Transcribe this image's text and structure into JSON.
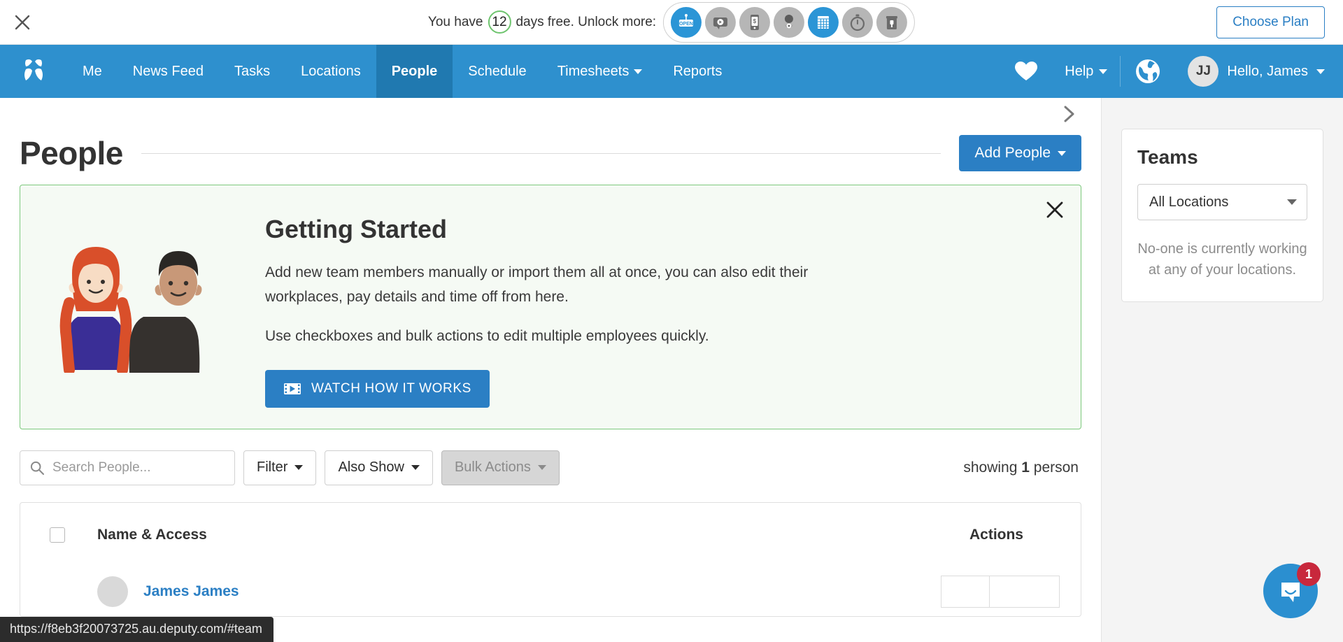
{
  "trial_banner": {
    "close_icon": "close-icon",
    "text_before": "You have",
    "days": "12",
    "text_after": "days free. Unlock more:",
    "feature_icons": [
      {
        "name": "open-sign-icon",
        "active": true
      },
      {
        "name": "video-message-icon",
        "active": false
      },
      {
        "name": "mobile-payments-icon",
        "active": false
      },
      {
        "name": "location-pin-person-icon",
        "active": false
      },
      {
        "name": "calendar-icon",
        "active": true
      },
      {
        "name": "stopwatch-icon",
        "active": false
      },
      {
        "name": "kiosk-icon",
        "active": false
      }
    ],
    "choose_plan_label": "Choose Plan"
  },
  "navbar": {
    "logo": "deputy-logo",
    "items": [
      {
        "label": "Me",
        "active": false,
        "has_caret": false
      },
      {
        "label": "News Feed",
        "active": false,
        "has_caret": false
      },
      {
        "label": "Tasks",
        "active": false,
        "has_caret": false
      },
      {
        "label": "Locations",
        "active": false,
        "has_caret": false
      },
      {
        "label": "People",
        "active": true,
        "has_caret": false
      },
      {
        "label": "Schedule",
        "active": false,
        "has_caret": false
      },
      {
        "label": "Timesheets",
        "active": false,
        "has_caret": true
      },
      {
        "label": "Reports",
        "active": false,
        "has_caret": false
      }
    ],
    "heart_icon": "heart-icon",
    "help_label": "Help",
    "globe_icon": "globe-icon",
    "user_initials": "JJ",
    "user_greeting": "Hello, James",
    "accent_color": "#2e90ce",
    "active_color": "#2079b0"
  },
  "main": {
    "page_title": "People",
    "add_people_label": "Add People",
    "collapse_icon": "chevron-right-icon",
    "getting_started": {
      "heading": "Getting Started",
      "paragraph_1": "Add new team members manually or import them all at once, you can also edit their workplaces, pay details and time off from here.",
      "paragraph_2": "Use checkboxes and bulk actions to edit multiple employees quickly.",
      "watch_label": "WATCH HOW IT WORKS",
      "close_icon": "close-icon",
      "border_color": "#7dc97d",
      "background_color": "#f5faf4"
    },
    "toolbar": {
      "search_placeholder": "Search People...",
      "search_value": "",
      "filter_label": "Filter",
      "also_show_label": "Also Show",
      "bulk_actions_label": "Bulk Actions",
      "bulk_actions_disabled": true,
      "showing_prefix": "showing",
      "showing_count": "1",
      "showing_suffix": "person"
    },
    "table": {
      "columns": [
        "Name & Access",
        "Actions"
      ],
      "rows": [
        {
          "name": "James James"
        }
      ]
    }
  },
  "sidebar": {
    "teams_title": "Teams",
    "location_selected": "All Locations",
    "empty_message": "No-one is currently working at any of your locations."
  },
  "chat": {
    "icon": "chat-bubble-icon",
    "badge_count": "1",
    "color": "#2b8fd0",
    "badge_color": "#c8283c"
  },
  "status_bar": {
    "url": "https://f8eb3f20073725.au.deputy.com/#team"
  }
}
